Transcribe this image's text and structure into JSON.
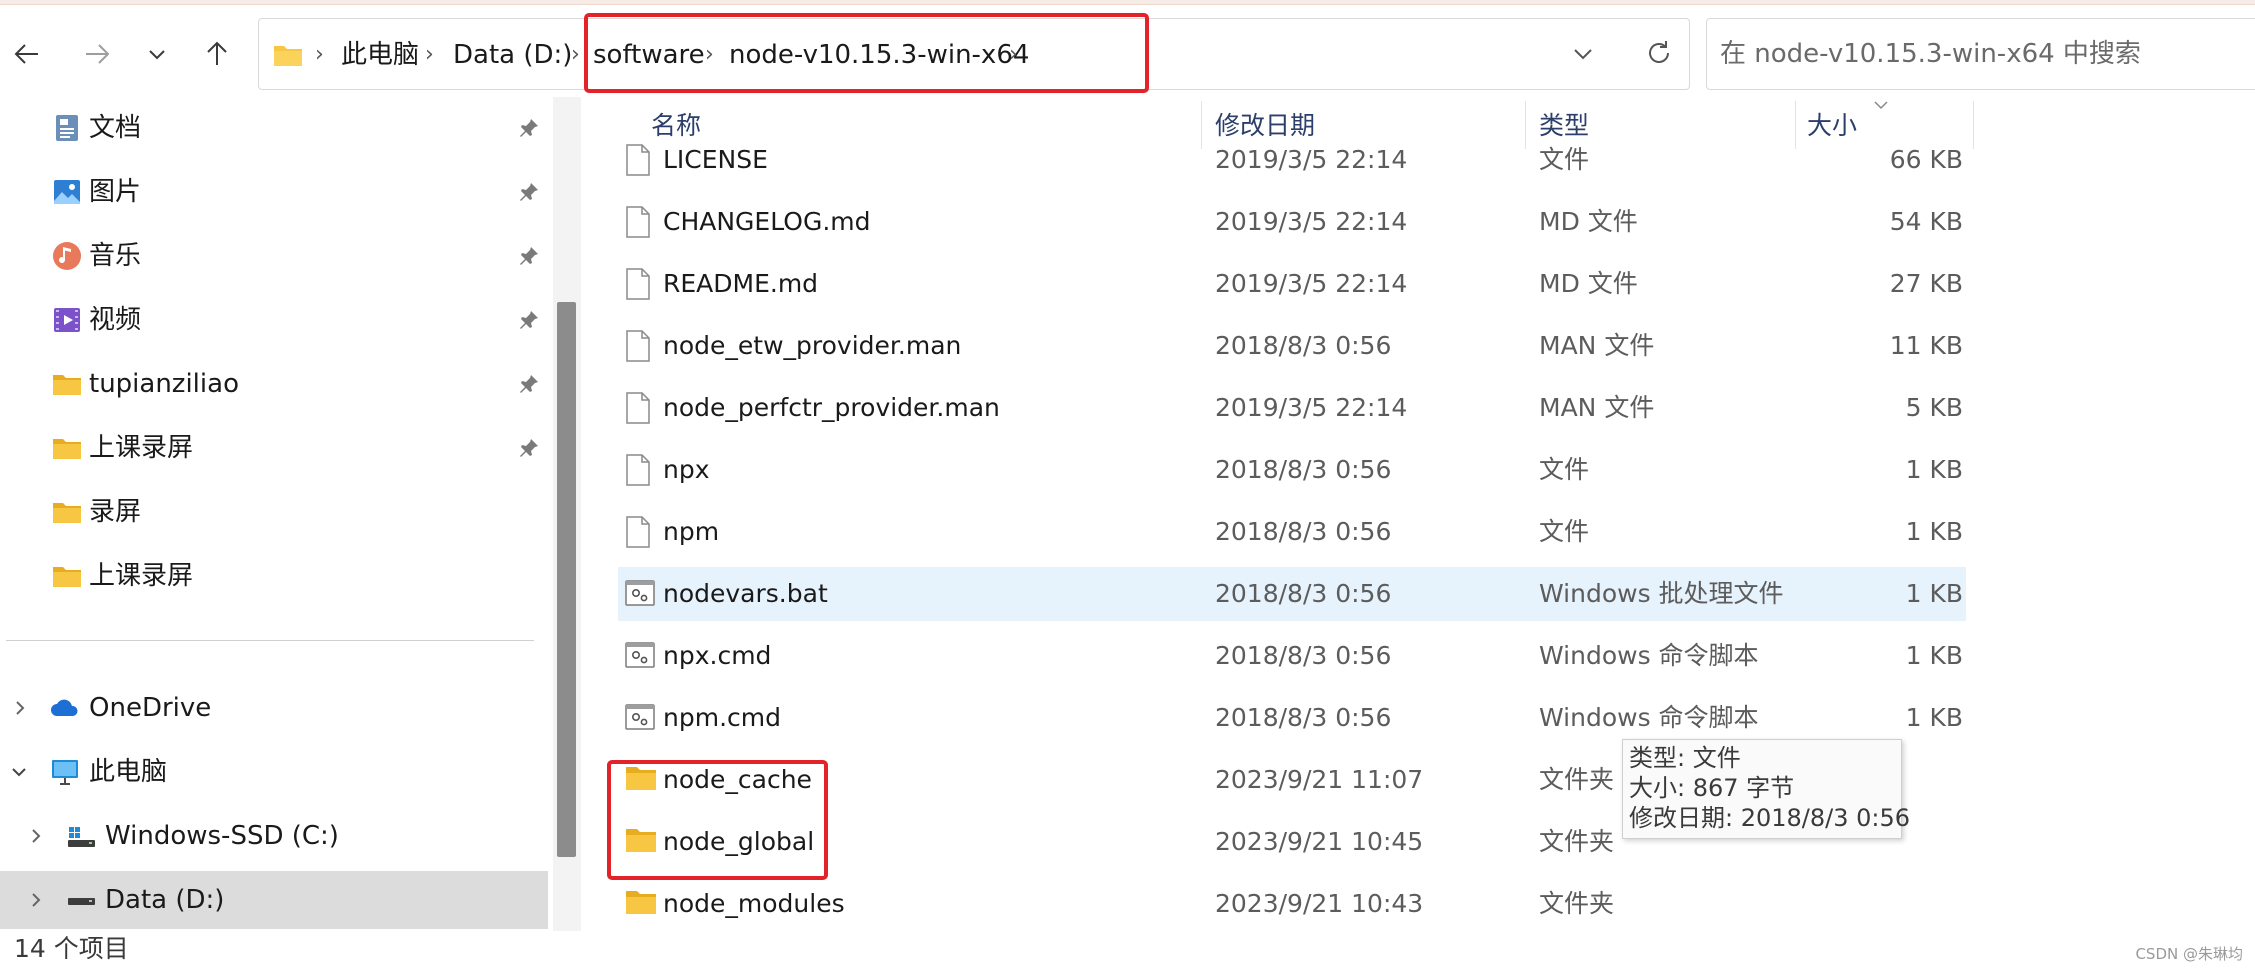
{
  "nav": {
    "back_icon": "arrow-left-icon",
    "forward_icon": "arrow-right-icon",
    "recent_icon": "chevron-down-icon",
    "up_icon": "arrow-up-icon"
  },
  "address": {
    "breadcrumbs": [
      "此电脑",
      "Data (D:)",
      "software",
      "node-v10.15.3-win-x64"
    ],
    "dropdown_icon": "chevron-down-icon",
    "refresh_icon": "refresh-icon"
  },
  "search": {
    "placeholder": "在 node-v10.15.3-win-x64 中搜索",
    "value": ""
  },
  "sidebar": {
    "quick_access": [
      {
        "label": "文档",
        "icon": "documents-icon",
        "pinned": true
      },
      {
        "label": "图片",
        "icon": "pictures-icon",
        "pinned": true
      },
      {
        "label": "音乐",
        "icon": "music-icon",
        "pinned": true
      },
      {
        "label": "视频",
        "icon": "videos-icon",
        "pinned": true
      },
      {
        "label": "tupianziliao",
        "icon": "folder-icon",
        "pinned": true
      },
      {
        "label": "上课录屏",
        "icon": "folder-icon",
        "pinned": true
      },
      {
        "label": "录屏",
        "icon": "folder-icon",
        "pinned": false
      },
      {
        "label": "上课录屏",
        "icon": "folder-icon",
        "pinned": false
      }
    ],
    "tree": [
      {
        "label": "OneDrive",
        "icon": "onedrive-icon",
        "expanded": false,
        "level": 0
      },
      {
        "label": "此电脑",
        "icon": "this-pc-icon",
        "expanded": true,
        "level": 0
      },
      {
        "label": "Windows-SSD (C:)",
        "icon": "windows-drive-icon",
        "expanded": false,
        "level": 1
      },
      {
        "label": "Data (D:)",
        "icon": "drive-icon",
        "expanded": false,
        "level": 1,
        "selected": true
      }
    ]
  },
  "columns": {
    "name": "名称",
    "date": "修改日期",
    "type": "类型",
    "size": "大小"
  },
  "files": [
    {
      "name": "LICENSE",
      "date": "2019/3/5 22:14",
      "type": "文件",
      "size": "66 KB",
      "icon": "file-icon"
    },
    {
      "name": "CHANGELOG.md",
      "date": "2019/3/5 22:14",
      "type": "MD 文件",
      "size": "54 KB",
      "icon": "file-icon"
    },
    {
      "name": "README.md",
      "date": "2019/3/5 22:14",
      "type": "MD 文件",
      "size": "27 KB",
      "icon": "file-icon"
    },
    {
      "name": "node_etw_provider.man",
      "date": "2018/8/3 0:56",
      "type": "MAN 文件",
      "size": "11 KB",
      "icon": "file-icon"
    },
    {
      "name": "node_perfctr_provider.man",
      "date": "2019/3/5 22:14",
      "type": "MAN 文件",
      "size": "5 KB",
      "icon": "file-icon"
    },
    {
      "name": "npx",
      "date": "2018/8/3 0:56",
      "type": "文件",
      "size": "1 KB",
      "icon": "file-icon"
    },
    {
      "name": "npm",
      "date": "2018/8/3 0:56",
      "type": "文件",
      "size": "1 KB",
      "icon": "file-icon"
    },
    {
      "name": "nodevars.bat",
      "date": "2018/8/3 0:56",
      "type": "Windows 批处理文件",
      "size": "1 KB",
      "icon": "script-icon",
      "hovered": true
    },
    {
      "name": "npx.cmd",
      "date": "2018/8/3 0:56",
      "type": "Windows 命令脚本",
      "size": "1 KB",
      "icon": "script-icon"
    },
    {
      "name": "npm.cmd",
      "date": "2018/8/3 0:56",
      "type": "Windows 命令脚本",
      "size": "1 KB",
      "icon": "script-icon"
    },
    {
      "name": "node_cache",
      "date": "2023/9/21 11:07",
      "type": "文件夹",
      "size": "",
      "icon": "folder-icon"
    },
    {
      "name": "node_global",
      "date": "2023/9/21 10:45",
      "type": "文件夹",
      "size": "",
      "icon": "folder-icon"
    },
    {
      "name": "node_modules",
      "date": "2023/9/21 10:43",
      "type": "文件夹",
      "size": "",
      "icon": "folder-icon"
    }
  ],
  "tooltip": {
    "line1": "类型: 文件",
    "line2": "大小: 867 字节",
    "line3": "修改日期: 2018/8/3 0:56"
  },
  "status": {
    "item_count": "14 个项目",
    "watermark": "CSDN @朱琳均"
  },
  "colors": {
    "highlight_box": "#e2232a",
    "hover_row": "#e6f2fc",
    "selected_nav": "#dcdcdc",
    "folder": "#f7c744",
    "column_header": "#2c3f6a"
  }
}
